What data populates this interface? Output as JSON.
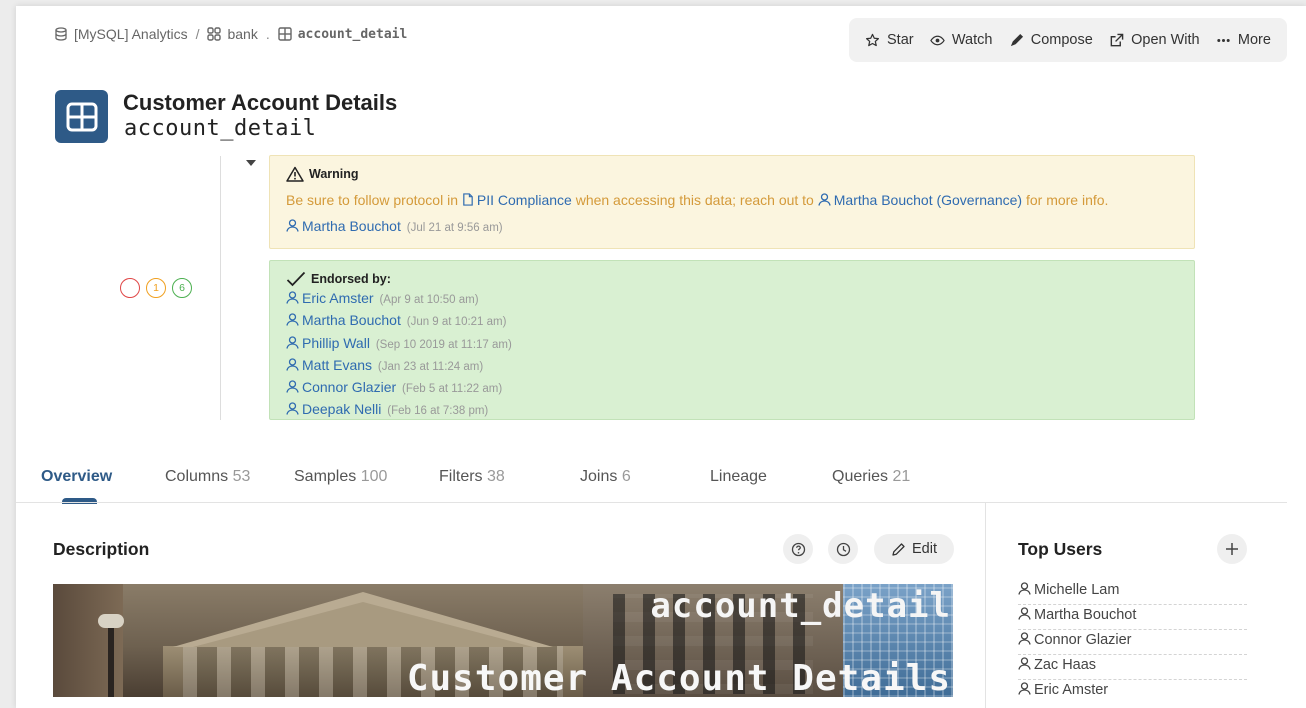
{
  "breadcrumb": {
    "database": "[MySQL] Analytics",
    "schema": "bank",
    "table": "account_detail",
    "separator": "/",
    "dot": "."
  },
  "toolbar": {
    "star": "Star",
    "watch": "Watch",
    "compose": "Compose",
    "open_with": "Open With",
    "more": "More"
  },
  "header": {
    "title": "Customer Account Details",
    "subtitle": "account_detail"
  },
  "counters": [
    {
      "value": "",
      "color": "#e04848"
    },
    {
      "value": "1",
      "color": "#f0a020"
    },
    {
      "value": "6",
      "color": "#4cb050"
    }
  ],
  "warning": {
    "heading": "Warning",
    "text_before": "Be sure to follow protocol in ",
    "doc_link": "PII Compliance",
    "text_middle": " when accessing this data; reach out to ",
    "person_link": "Martha Bouchot (Governance)",
    "text_after": " for more info.",
    "author": "Martha Bouchot",
    "author_time": "(Jul 21 at 9:56 am)"
  },
  "endorsement": {
    "heading": "Endorsed by:",
    "people": [
      {
        "name": "Eric Amster",
        "time": "(Apr 9 at 10:50 am)"
      },
      {
        "name": "Martha Bouchot",
        "time": "(Jun 9 at 10:21 am)"
      },
      {
        "name": "Phillip Wall",
        "time": "(Sep 10 2019 at 11:17 am)"
      },
      {
        "name": "Matt Evans",
        "time": "(Jan 23 at 11:24 am)"
      },
      {
        "name": "Connor Glazier",
        "time": "(Feb 5 at 11:22 am)"
      },
      {
        "name": "Deepak Nelli",
        "time": "(Feb 16 at 7:38 pm)"
      }
    ]
  },
  "tabs": [
    {
      "label": "Overview",
      "count": ""
    },
    {
      "label": "Columns",
      "count": "53"
    },
    {
      "label": "Samples",
      "count": "100"
    },
    {
      "label": "Filters",
      "count": "38"
    },
    {
      "label": "Joins",
      "count": "6"
    },
    {
      "label": "Lineage",
      "count": ""
    },
    {
      "label": "Queries",
      "count": "21"
    }
  ],
  "description": {
    "title": "Description",
    "edit_label": "Edit",
    "banner_line1": "account_detail",
    "banner_line2": "Customer Account Details"
  },
  "top_users": {
    "title": "Top Users",
    "users": [
      "Michelle Lam",
      "Martha Bouchot",
      "Connor Glazier",
      "Zac Haas",
      "Eric Amster"
    ]
  },
  "colors": {
    "accent": "#2e5a87",
    "link": "#2f6bb0",
    "warning_bg": "#fbf5df",
    "warning_text": "#d49a3a",
    "endorse_bg": "#d9f0d2"
  }
}
